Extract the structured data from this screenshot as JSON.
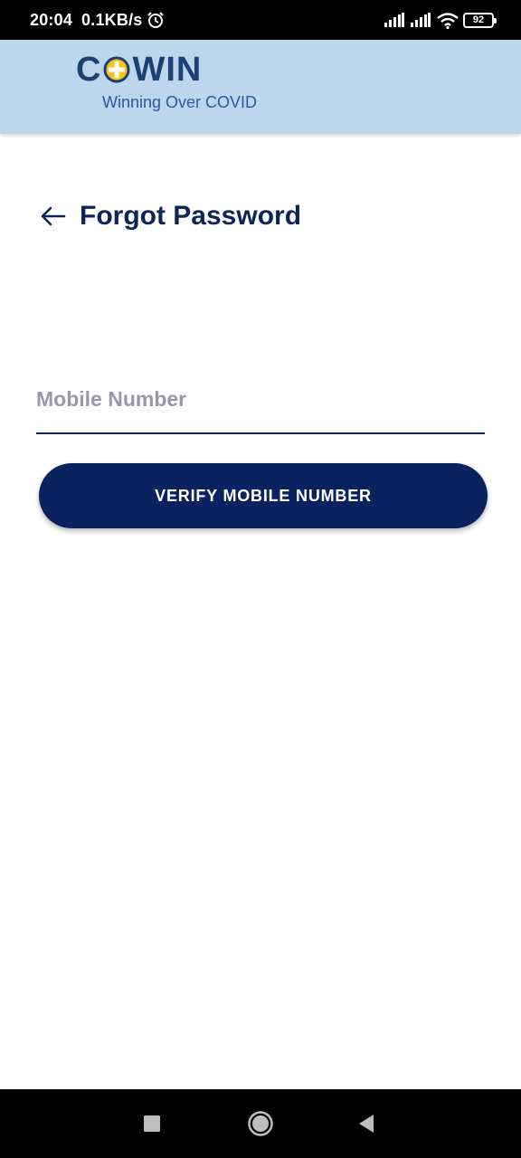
{
  "status_bar": {
    "time": "20:04",
    "net_speed": "0.1KB/s",
    "battery_level": "92",
    "icons": [
      "alarm-icon",
      "signal-icon",
      "signal-icon",
      "wifi-icon",
      "battery-icon"
    ]
  },
  "header": {
    "logo_left": "C",
    "logo_right": "WIN",
    "tagline": "Winning Over COVID"
  },
  "page": {
    "title": "Forgot Password",
    "back_icon": "arrow-left-icon"
  },
  "form": {
    "mobile_placeholder": "Mobile Number",
    "mobile_value": "",
    "verify_label": "VERIFY MOBILE NUMBER"
  },
  "nav_bar": {
    "icons": [
      "recents-icon",
      "home-icon",
      "back-icon"
    ]
  },
  "colors": {
    "header_bg": "#bcd7ed",
    "brand_navy": "#0b2260",
    "logo_blue": "#1f3f77",
    "plus_yellow": "#f5c518"
  }
}
